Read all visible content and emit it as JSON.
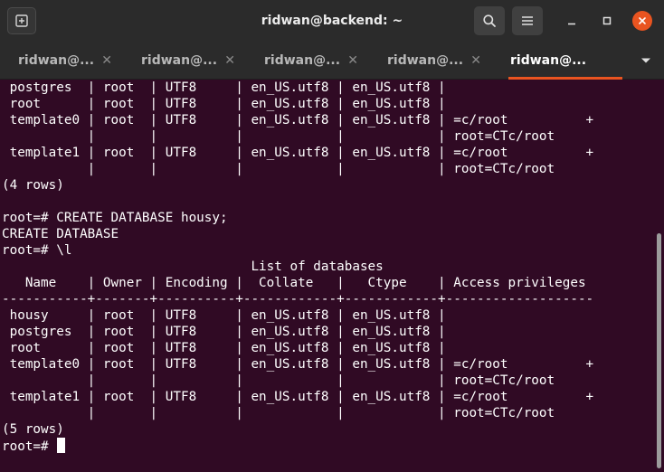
{
  "window": {
    "title": "ridwan@backend: ~",
    "accent_color": "#e95420",
    "background_color": "#300a24"
  },
  "header_icons": {
    "new_tab": "new-tab-icon",
    "search": "search-icon",
    "menu": "hamburger-menu-icon",
    "minimize": "minimize-icon",
    "maximize": "maximize-icon",
    "close": "close-icon"
  },
  "tabs": [
    {
      "label": "ridwan@...",
      "active": false
    },
    {
      "label": "ridwan@...",
      "active": false
    },
    {
      "label": "ridwan@...",
      "active": false
    },
    {
      "label": "ridwan@...",
      "active": false
    },
    {
      "label": "ridwan@...",
      "active": true
    }
  ],
  "terminal": {
    "lines": [
      " postgres  | root  | UTF8     | en_US.utf8 | en_US.utf8 | ",
      " root      | root  | UTF8     | en_US.utf8 | en_US.utf8 | ",
      " template0 | root  | UTF8     | en_US.utf8 | en_US.utf8 | =c/root          +",
      "           |       |          |            |            | root=CTc/root",
      " template1 | root  | UTF8     | en_US.utf8 | en_US.utf8 | =c/root          +",
      "           |       |          |            |            | root=CTc/root",
      "(4 rows)",
      "",
      "root=# CREATE DATABASE housy;",
      "CREATE DATABASE",
      "root=# \\l",
      "                                List of databases",
      "   Name    | Owner | Encoding |  Collate   |   Ctype    | Access privileges",
      "-----------+-------+----------+------------+------------+-------------------",
      " housy     | root  | UTF8     | en_US.utf8 | en_US.utf8 | ",
      " postgres  | root  | UTF8     | en_US.utf8 | en_US.utf8 | ",
      " root      | root  | UTF8     | en_US.utf8 | en_US.utf8 | ",
      " template0 | root  | UTF8     | en_US.utf8 | en_US.utf8 | =c/root          +",
      "           |       |          |            |            | root=CTc/root",
      " template1 | root  | UTF8     | en_US.utf8 | en_US.utf8 | =c/root          +",
      "           |       |          |            |            | root=CTc/root",
      "(5 rows)",
      ""
    ],
    "prompt": "root=# "
  }
}
